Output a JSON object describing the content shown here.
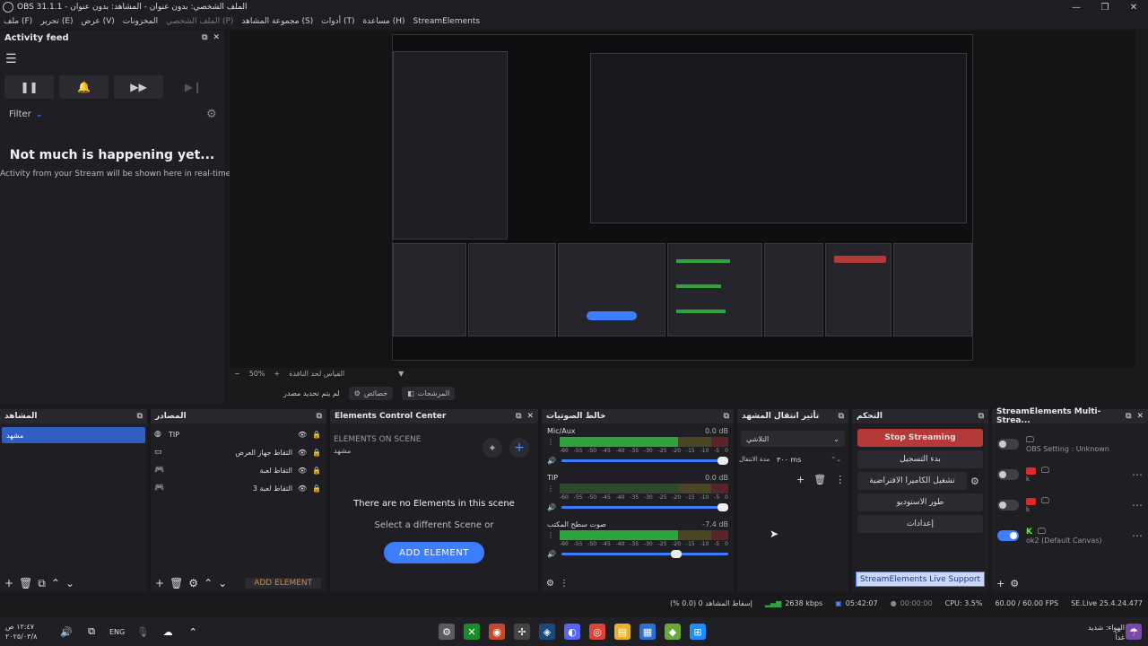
{
  "window": {
    "title": "OBS 31.1.1 - الملف الشخصي: بدون عنوان - المشاهد: بدون عنوان",
    "menu": [
      {
        "label": "ملف (F)",
        "dim": false
      },
      {
        "label": "تحرير (E)",
        "dim": false
      },
      {
        "label": "عرض (V)",
        "dim": false
      },
      {
        "label": "المخزونات",
        "dim": false
      },
      {
        "label": "الملف الشخصي (P)",
        "dim": true
      },
      {
        "label": "مجموعة المشاهد (S)",
        "dim": false
      },
      {
        "label": "أدوات (T)",
        "dim": false
      },
      {
        "label": "مساعدة (H)",
        "dim": false
      },
      {
        "label": "StreamElements",
        "dim": false
      }
    ]
  },
  "activity": {
    "title": "Activity feed",
    "filter_label": "Filter",
    "empty_title": "Not much is happening yet...",
    "empty_sub": "Activity from your Stream will be shown here in real-time"
  },
  "preview": {
    "zoom": "50%",
    "zoom_mode": "القياس لحد النافذة",
    "no_source": "لم يتم تحديد مصدر",
    "props_label": "خصائص",
    "filters_label": "المرشحات"
  },
  "scenes": {
    "title": "المشاهد",
    "items": [
      "مشهد"
    ]
  },
  "sources": {
    "title": "المصادر",
    "items": [
      "TIP",
      "التقاط جهاز العرض",
      "التقاط لعبة",
      "التقاط لعبة 3"
    ],
    "add_element": "ADD ELEMENT"
  },
  "elements": {
    "title": "Elements Control Center",
    "on_scene": "ELEMENTS ON SCENE",
    "scene_name": "مشهد",
    "empty_title": "There are no Elements in this scene",
    "empty_sub": "Select a different Scene or",
    "add_button": "ADD ELEMENT"
  },
  "mixer": {
    "title": "خالط الصوتيات",
    "channels": [
      {
        "name": "Mic/Aux",
        "db": "0.0 dB",
        "level": 0.72,
        "slider": 1.0
      },
      {
        "name": "TIP",
        "db": "0.0 dB",
        "level": 0.0,
        "slider": 1.0
      },
      {
        "name": "صوت سطح المكتب",
        "db": "-7.4 dB",
        "level": 0.7,
        "slider": 0.72
      }
    ],
    "ticks": [
      "-60",
      "-55",
      "-50",
      "-45",
      "-40",
      "-35",
      "-30",
      "-25",
      "-20",
      "-15",
      "-10",
      "-5",
      "0"
    ]
  },
  "transitions": {
    "title": "تأثير انتقال المشهد",
    "selected": "التلاشي",
    "duration_label": "مدة الانتقال",
    "duration_value": "٣٠٠ ms"
  },
  "controls": {
    "title": "التحكم",
    "stop_streaming": "Stop Streaming",
    "start_recording": "بدء التسجيل",
    "virtual_camera": "تشغيل الكاميرا الافتراضية",
    "studio_mode": "طور الاستوديو",
    "settings": "إعدادات",
    "support": "StreamElements Live Support"
  },
  "multistream": {
    "title": "StreamElements Multi-Strea...",
    "rows": [
      {
        "label": "OBS Setting : Unknown",
        "sub": "",
        "on": false
      },
      {
        "label": "",
        "sub": "k",
        "on": false
      },
      {
        "label": "",
        "sub": "k",
        "on": false
      },
      {
        "label": "ok2 (Default Canvas)",
        "sub": "",
        "on": true
      }
    ]
  },
  "status": {
    "dropped": "إسقاط المشاهد 0 (0.0 %)",
    "bitrate": "2638 kbps",
    "stream_time": "05:42:07",
    "rec_time": "00:00:00",
    "cpu": "CPU: 3.5%",
    "fps": "60.00 / 60.00 FPS",
    "version": "SE.Live 25.4.24.477"
  },
  "taskbar": {
    "time": "١٢:٤٧ ص",
    "date": "٢٠٢٥/٠٣/٨",
    "lang": "ENG",
    "weather_title": "الهواء: شديد",
    "weather_sub": "غداً"
  },
  "colors": {
    "accent": "#3d7eff",
    "stop": "#b33a36",
    "meter_green": "#2ea33e",
    "meter_yellow": "#b0a02a",
    "meter_red": "#b5282f"
  }
}
